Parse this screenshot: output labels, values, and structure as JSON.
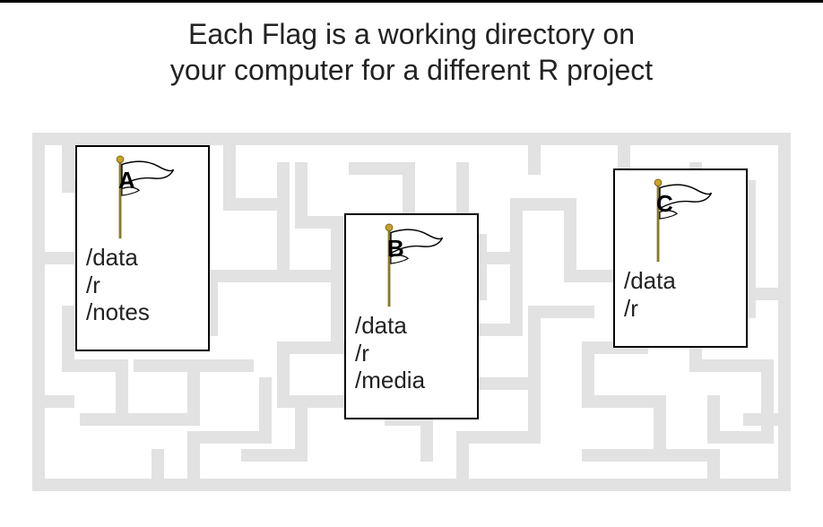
{
  "title_line1": "Each Flag is a working directory on",
  "title_line2": "your computer for a different R project",
  "flags": {
    "a": {
      "letter": "A",
      "dirs": [
        "/data",
        "/r",
        "/notes"
      ]
    },
    "b": {
      "letter": "B",
      "dirs": [
        "/data",
        "/r",
        "/media"
      ]
    },
    "c": {
      "letter": "C",
      "dirs": [
        "/data",
        "/r"
      ]
    }
  }
}
